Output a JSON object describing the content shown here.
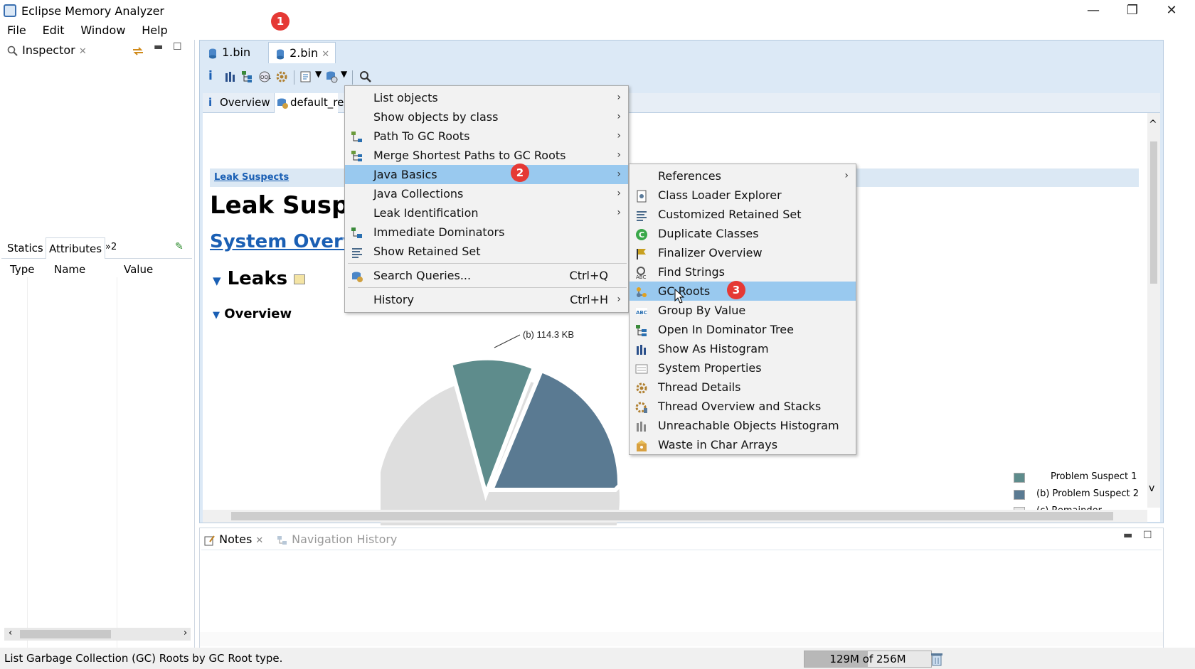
{
  "window": {
    "title": "Eclipse Memory Analyzer",
    "controls": [
      "—",
      "❐",
      "✕"
    ]
  },
  "menubar": [
    "File",
    "Edit",
    "Window",
    "Help"
  ],
  "badges": [
    "1",
    "2",
    "3"
  ],
  "inspector": {
    "tab_label": "Inspector",
    "tabs": [
      "Statics",
      "Attributes",
      "»2"
    ],
    "columns": [
      "Type",
      "Name",
      "Value"
    ]
  },
  "editor": {
    "tabs": [
      {
        "label": "1.bin"
      },
      {
        "label": "2.bin"
      }
    ],
    "subtabs": [
      "Overview",
      "default_re"
    ]
  },
  "report": {
    "breadcrumb": "Leak Suspects",
    "heading": "Leak Susp",
    "system_overview_link": "System Overv",
    "leaks_heading": "Leaks",
    "overview_heading": "Overview",
    "pie_label_b": "(b)  114.3 KB",
    "legend": [
      {
        "label": "Problem Suspect 1",
        "color": "#5e8c8c"
      },
      {
        "label": "(b)  Problem Suspect 2",
        "color": "#5a7a92"
      },
      {
        "label": "(c)  Remainder",
        "color": "#e0e0e0"
      }
    ],
    "pie": [
      {
        "name": "a",
        "value": 14,
        "color": "#5e8c8c"
      },
      {
        "name": "b",
        "value": 20,
        "color": "#5a7a92"
      },
      {
        "name": "c",
        "value": 66,
        "color": "#dedede"
      }
    ]
  },
  "context_menu": {
    "items": [
      {
        "label": "List objects",
        "icon": "",
        "submenu": true,
        "shortcut": ""
      },
      {
        "label": "Show objects by class",
        "icon": "",
        "submenu": true,
        "shortcut": ""
      },
      {
        "label": "Path To GC Roots",
        "icon": "path-icon",
        "submenu": true,
        "shortcut": ""
      },
      {
        "label": "Merge Shortest Paths to GC Roots",
        "icon": "merge-icon",
        "submenu": true,
        "shortcut": ""
      },
      {
        "label": "Java Basics",
        "icon": "",
        "submenu": true,
        "shortcut": "",
        "highlighted": true
      },
      {
        "label": "Java Collections",
        "icon": "",
        "submenu": true,
        "shortcut": ""
      },
      {
        "label": "Leak Identification",
        "icon": "",
        "submenu": true,
        "shortcut": ""
      },
      {
        "label": "Immediate Dominators",
        "icon": "dominator-icon",
        "submenu": false,
        "shortcut": ""
      },
      {
        "label": "Show Retained Set",
        "icon": "retained-icon",
        "submenu": false,
        "shortcut": ""
      },
      {
        "label": "Search Queries...",
        "icon": "query-icon",
        "submenu": false,
        "shortcut": "Ctrl+Q"
      },
      {
        "label": "History",
        "icon": "",
        "submenu": true,
        "shortcut": "Ctrl+H"
      }
    ]
  },
  "submenu": {
    "items": [
      {
        "label": "References",
        "icon": "",
        "submenu": true
      },
      {
        "label": "Class Loader Explorer",
        "icon": "classloader-icon"
      },
      {
        "label": "Customized Retained Set",
        "icon": "retained-icon"
      },
      {
        "label": "Duplicate Classes",
        "icon": "duplicate-icon"
      },
      {
        "label": "Finalizer Overview",
        "icon": "finalizer-icon"
      },
      {
        "label": "Find Strings",
        "icon": "find-strings-icon"
      },
      {
        "label": "GC Roots",
        "icon": "gc-roots-icon",
        "highlighted": true
      },
      {
        "label": "Group By Value",
        "icon": "group-icon"
      },
      {
        "label": "Open In Dominator Tree",
        "icon": "dominator-tree-icon"
      },
      {
        "label": "Show As Histogram",
        "icon": "histogram-icon"
      },
      {
        "label": "System Properties",
        "icon": "properties-icon"
      },
      {
        "label": "Thread Details",
        "icon": "thread-icon"
      },
      {
        "label": "Thread Overview and Stacks",
        "icon": "thread-stacks-icon"
      },
      {
        "label": "Unreachable Objects Histogram",
        "icon": "unreachable-icon"
      },
      {
        "label": "Waste in Char Arrays",
        "icon": "waste-icon"
      }
    ]
  },
  "bottom": {
    "tabs": [
      "Notes",
      "Navigation History"
    ]
  },
  "status": {
    "message": "List Garbage Collection (GC) Roots by GC Root type.",
    "heap": "129M of 256M"
  },
  "colors": {
    "highlight": "#99c9ef",
    "badge": "#e53935",
    "link": "#1a5fb4"
  }
}
